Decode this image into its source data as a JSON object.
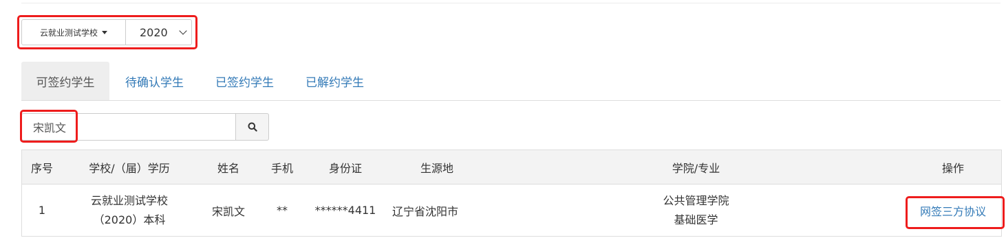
{
  "filters": {
    "school_label": "云就业测试学校",
    "year_value": "2020"
  },
  "tabs": [
    {
      "label": "可签约学生",
      "active": true
    },
    {
      "label": "待确认学生",
      "active": false
    },
    {
      "label": "已签约学生",
      "active": false
    },
    {
      "label": "已解约学生",
      "active": false
    }
  ],
  "search": {
    "value": "宋凯文",
    "icon": "search-icon"
  },
  "table": {
    "headers": [
      "序号",
      "学校/（届）学历",
      "姓名",
      "手机",
      "身份证",
      "生源地",
      "学院/专业",
      "操作"
    ],
    "rows": [
      {
        "index": "1",
        "school": "云就业测试学校",
        "year_edu": "（2020）本科",
        "name": "宋凯文",
        "phone": "**",
        "id_card": "******4411",
        "origin": "辽宁省沈阳市",
        "college": "公共管理学院",
        "major": "基础医学",
        "action": "网签三方协议"
      }
    ]
  },
  "colors": {
    "link": "#337ab7",
    "highlight": "#ee1c1c",
    "header_bg": "#f3f3f3",
    "active_tab_bg": "#eeeeee"
  }
}
